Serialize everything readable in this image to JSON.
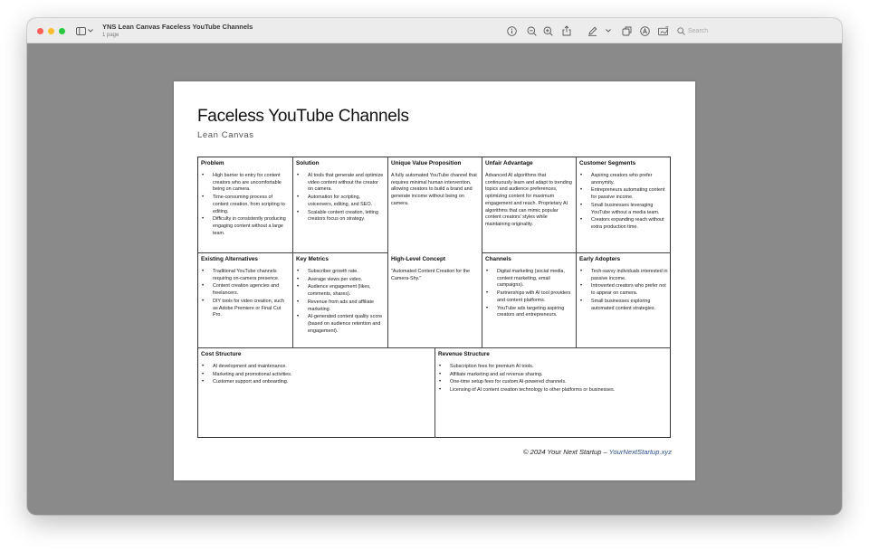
{
  "app": {
    "doc_title": "YNS Lean Canvas Faceless YouTube Channels",
    "doc_subtitle": "1 page",
    "search_placeholder": "Search",
    "traffic_lights": {
      "close": "#fe5f57",
      "minimize": "#febc2e",
      "zoom": "#28c840"
    }
  },
  "toolbar_icons": [
    "sidebar-icon",
    "info-icon",
    "zoom-out-icon",
    "zoom-in-icon",
    "share-icon",
    "markup-pen-icon",
    "chevron-down-icon",
    "window-icon",
    "highlight-icon",
    "annotate-icon",
    "search-icon"
  ],
  "page": {
    "title": "Faceless YouTube Channels",
    "subtitle": "Lean Canvas",
    "footer_text": "© 2024 Your Next Startup – ",
    "footer_link": "YourNextStartup.xyz"
  },
  "canvas": {
    "problem": {
      "title": "Problem",
      "items": [
        "High barrier to entry for content creators who are uncomfortable being on camera.",
        "Time-consuming process of content creation, from scripting to editing.",
        "Difficulty in consistently producing engaging content without a large team."
      ]
    },
    "solution": {
      "title": "Solution",
      "items": [
        "AI tools that generate and optimize video content without the creator on camera.",
        "Automation for scripting, voiceovers, editing, and SEO.",
        "Scalable content creation, letting creators focus on strategy."
      ]
    },
    "uvp": {
      "title": "Unique Value Proposition",
      "text": "A fully automated YouTube channel that requires minimal human intervention, allowing creators to build a brand and generate income without being on camera."
    },
    "unfair_advantage": {
      "title": "Unfair Advantage",
      "text": "Advanced AI algorithms that continuously learn and adapt to trending topics and audience preferences, optimizing content for maximum engagement and reach. Proprietary AI algorithms that can mimic popular content creators' styles while maintaining originality."
    },
    "customer_segments": {
      "title": "Customer Segments",
      "items": [
        "Aspiring creators who prefer anonymity.",
        "Entrepreneurs automating content for passive income.",
        "Small businesses leveraging YouTube without a media team.",
        "Creators expanding reach without extra production time."
      ]
    },
    "existing_alternatives": {
      "title": "Existing Alternatives",
      "items": [
        "Traditional YouTube channels requiring on-camera presence.",
        "Content creation agencies and freelancers.",
        "DIY tools for video creation, such as Adobe Premiere or Final Cut Pro."
      ]
    },
    "key_metrics": {
      "title": "Key Metrics",
      "items": [
        "Subscriber growth rate.",
        "Average views per video.",
        "Audience engagement (likes, comments, shares).",
        "Revenue from ads and affiliate marketing.",
        "AI-generated content quality score (based on audience retention and engagement)."
      ]
    },
    "high_level_concept": {
      "title": "High-Level Concept",
      "text": "\"Automated Content Creation for the Camera-Shy.\""
    },
    "channels": {
      "title": "Channels",
      "items": [
        "Digital marketing (social media, content marketing, email campaigns).",
        "Partnerships with AI tool providers and content platforms.",
        "YouTube ads targeting aspiring creators and entrepreneurs."
      ]
    },
    "early_adopters": {
      "title": "Early Adopters",
      "items": [
        "Tech-savvy individuals interested in passive income.",
        "Introverted creators who prefer not to appear on camera.",
        "Small businesses exploring automated content strategies."
      ]
    },
    "cost_structure": {
      "title": "Cost Structure",
      "items": [
        "AI development and maintenance.",
        "Marketing and promotional activities.",
        "Customer support and onboarding."
      ]
    },
    "revenue_structure": {
      "title": "Revenue Structure",
      "items": [
        "Subscription fees for premium AI tools.",
        "Affiliate marketing and ad revenue sharing.",
        "One-time setup fees for custom AI-powered channels.",
        "Licensing of AI content creation technology to other platforms or businesses."
      ]
    }
  }
}
